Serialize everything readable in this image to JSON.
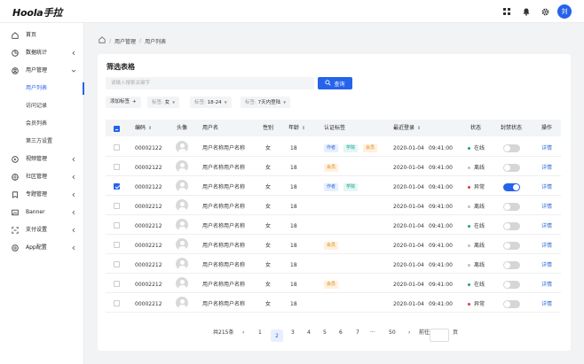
{
  "app": {
    "logo": "Hoola手拉",
    "avatar_letter": "刘"
  },
  "sidebar": {
    "items": [
      {
        "label": "首页",
        "icon": "home-icon"
      },
      {
        "label": "数据统计",
        "icon": "chart-icon"
      },
      {
        "label": "用户管理",
        "icon": "user-icon"
      },
      {
        "label": "用户列表"
      },
      {
        "label": "访问记录"
      },
      {
        "label": "会员列表"
      },
      {
        "label": "第三方设置"
      },
      {
        "label": "视频管理",
        "icon": "video-icon"
      },
      {
        "label": "社区管理",
        "icon": "community-icon"
      },
      {
        "label": "专题管理",
        "icon": "topic-icon"
      },
      {
        "label": "Banner",
        "icon": "image-icon"
      },
      {
        "label": "支付设置",
        "icon": "pay-icon"
      },
      {
        "label": "App配置",
        "icon": "settings-icon"
      }
    ]
  },
  "breadcrumb": [
    "用户管理",
    "用户列表"
  ],
  "card": {
    "title": "筛选表格"
  },
  "search": {
    "placeholder": "请输入搜索关键字",
    "button": "查询"
  },
  "filters": {
    "add_label": "添加标签",
    "items": [
      {
        "key": "标签:",
        "value": "女"
      },
      {
        "key": "标签:",
        "value": "18-24"
      },
      {
        "key": "标签:",
        "value": "7天内登陆"
      }
    ]
  },
  "table": {
    "columns": [
      "编码",
      "头像",
      "用户名",
      "性别",
      "年龄",
      "认证标签",
      "最近登录",
      "状态",
      "封禁状态",
      "操作"
    ],
    "rows": [
      {
        "code": "00002122",
        "name": "用户名称用户名称",
        "gender": "女",
        "age": "18",
        "tags": [
          "作者",
          "学院",
          "会员"
        ],
        "date": "2020-01-04",
        "time": "09:41:00",
        "status": "在线",
        "banned": false,
        "checked": false,
        "action": "详情"
      },
      {
        "code": "00002122",
        "name": "用户名称用户名称",
        "gender": "女",
        "age": "18",
        "tags": [
          "会员"
        ],
        "date": "2020-01-04",
        "time": "09:41:00",
        "status": "离线",
        "banned": false,
        "checked": false,
        "action": "详情"
      },
      {
        "code": "00002122",
        "name": "用户名称用户名称",
        "gender": "女",
        "age": "18",
        "tags": [
          "作者",
          "学院"
        ],
        "date": "2020-01-04",
        "time": "09:41:00",
        "status": "异常",
        "banned": true,
        "checked": true,
        "action": "详情"
      },
      {
        "code": "00002212",
        "name": "用户名称用户名称",
        "gender": "女",
        "age": "18",
        "tags": [],
        "date": "2020-01-04",
        "time": "09:41:00",
        "status": "离线",
        "banned": false,
        "checked": false,
        "action": "详情"
      },
      {
        "code": "00002212",
        "name": "用户名称用户名称",
        "gender": "女",
        "age": "18",
        "tags": [],
        "date": "2020-01-04",
        "time": "09:41:00",
        "status": "在线",
        "banned": false,
        "checked": false,
        "action": "详情"
      },
      {
        "code": "00002212",
        "name": "用户名称用户名称",
        "gender": "女",
        "age": "18",
        "tags": [
          "会员"
        ],
        "date": "2020-01-04",
        "time": "09:41:00",
        "status": "离线",
        "banned": false,
        "checked": false,
        "action": "详情"
      },
      {
        "code": "00002212",
        "name": "用户名称用户名称",
        "gender": "女",
        "age": "18",
        "tags": [],
        "date": "2020-01-04",
        "time": "09:41:00",
        "status": "离线",
        "banned": false,
        "checked": false,
        "action": "详情"
      },
      {
        "code": "00002212",
        "name": "用户名称用户名称",
        "gender": "女",
        "age": "18",
        "tags": [
          "会员"
        ],
        "date": "2020-01-04",
        "time": "09:41:00",
        "status": "在线",
        "banned": false,
        "checked": false,
        "action": "详情"
      },
      {
        "code": "00002212",
        "name": "用户名称用户名称",
        "gender": "女",
        "age": "18",
        "tags": [],
        "date": "2020-01-04",
        "time": "09:41:00",
        "status": "异常",
        "banned": false,
        "checked": false,
        "action": "详情"
      }
    ]
  },
  "pagination": {
    "total": "共215条",
    "pages": [
      "1",
      "2",
      "3",
      "4",
      "5",
      "6",
      "7",
      "···",
      "50"
    ],
    "current": "2",
    "prev": "‹",
    "next": "›",
    "goto_label": "前往",
    "page_unit": "页"
  },
  "colors": {
    "accent": "#2563eb",
    "status_online": "#1aa08a",
    "status_offline": "#c0c0c0",
    "status_error": "#e53935",
    "tag_blue": "#2f6bd9",
    "tag_teal": "#1aa08a",
    "tag_orange": "#e08a16"
  }
}
